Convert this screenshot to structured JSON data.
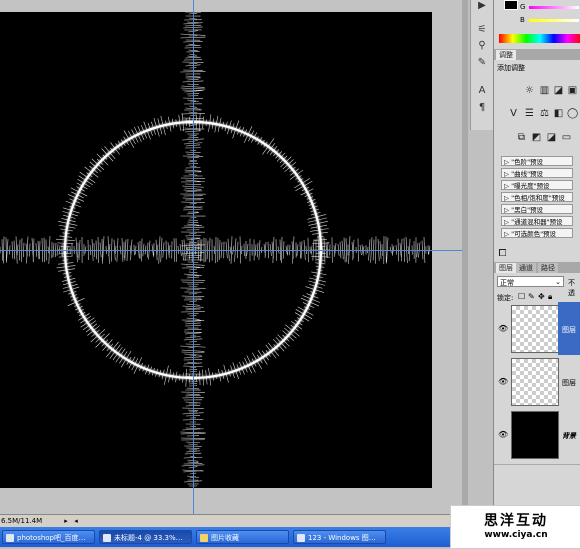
{
  "statusbar": {
    "doc_size": "6.5M/11.4M"
  },
  "taskbar": {
    "items": [
      {
        "label": "photoshop吧_百度…",
        "icon": "ie-icon"
      },
      {
        "label": "未标题-4 @ 33.3%…",
        "icon": "photoshop-icon"
      },
      {
        "label": "图片收藏",
        "icon": "folder-icon"
      },
      {
        "label": "123 - Windows 图…",
        "icon": "image-viewer-icon"
      }
    ]
  },
  "color_panel": {
    "g_label": "G",
    "b_label": "B"
  },
  "adjustments": {
    "tab": "调整",
    "title": "添加调整",
    "presets": [
      "\"色阶\"预设",
      "\"曲线\"预设",
      "\"曝光度\"预设",
      "\"色相/饱和度\"预设",
      "\"黑白\"预设",
      "\"通道混和器\"预设",
      "\"可选颜色\"预设"
    ]
  },
  "layers": {
    "tabs": [
      "图层",
      "通道",
      "路径"
    ],
    "blend_mode": "正常",
    "opacity_label": "不透",
    "lock_label": "锁定:",
    "rows": [
      {
        "name": "图层",
        "type": "transparent",
        "selected": true
      },
      {
        "name": "图层",
        "type": "transparent",
        "selected": false
      },
      {
        "name": "背景",
        "type": "black",
        "selected": false
      }
    ]
  },
  "watermark": {
    "title": "思洋互动",
    "url": "www.ciya.cn"
  },
  "colors": {
    "canvas": "#000000",
    "guide": "#4a8ad8",
    "selected_layer": "#3a6bc4",
    "taskbar": "#245edb"
  }
}
